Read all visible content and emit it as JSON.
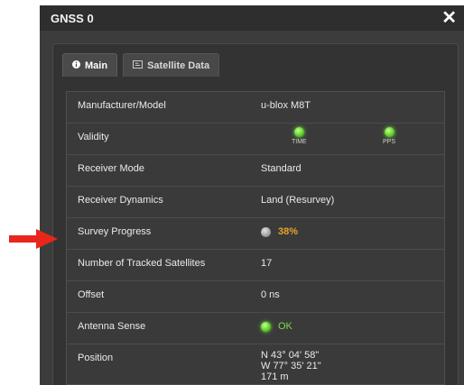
{
  "window": {
    "title": "GNSS 0",
    "close_symbol": "✕"
  },
  "tabs": [
    {
      "label": "Main",
      "icon": "info-icon"
    },
    {
      "label": "Satellite Data",
      "icon": "chart-icon"
    }
  ],
  "rows": {
    "manufacturer": {
      "label": "Manufacturer/Model",
      "value": "u-blox M8T"
    },
    "validity": {
      "label": "Validity",
      "time_label": "TIME",
      "pps_label": "PPS"
    },
    "receiver_mode": {
      "label": "Receiver Mode",
      "value": "Standard"
    },
    "receiver_dynamics": {
      "label": "Receiver Dynamics",
      "value": "Land (Resurvey)"
    },
    "survey_progress": {
      "label": "Survey Progress",
      "value": "38%"
    },
    "tracked_satellites": {
      "label": "Number of Tracked Satellites",
      "value": "17"
    },
    "offset": {
      "label": "Offset",
      "value": "0 ns"
    },
    "antenna_sense": {
      "label": "Antenna Sense",
      "value": "OK"
    },
    "position": {
      "label": "Position",
      "lat": "N 43° 04' 58\"",
      "lon": "W 77° 35' 21\"",
      "alt": "171 m"
    }
  },
  "colors": {
    "led_green": "#5fd12a",
    "led_gray": "#9e9e9e",
    "progress_text": "#e8a22a",
    "ok_text": "#7fd84a",
    "arrow": "#e8261b"
  }
}
